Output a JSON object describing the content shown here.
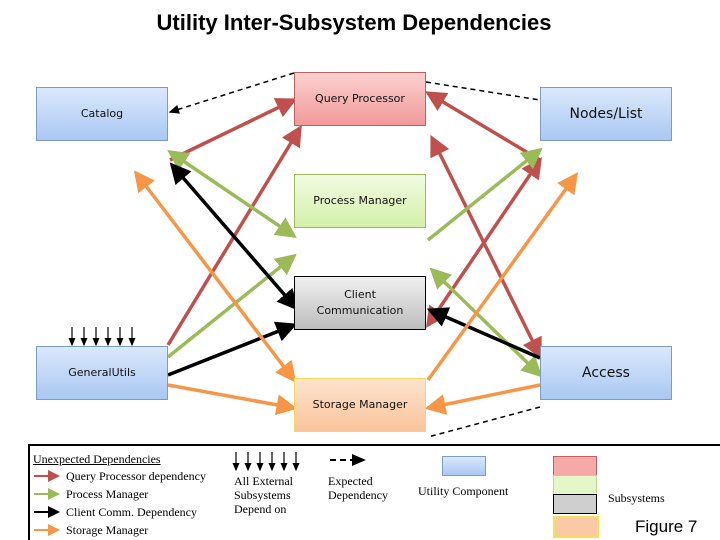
{
  "title": "Utility Inter-Subsystem Dependencies",
  "nodes": {
    "catalog": "Catalog",
    "query_processor": "Query Processor",
    "nodes_list": "Nodes/List",
    "process_manager": "Process Manager",
    "client_communication": "Client Communication",
    "general_utils": "GeneralUtils",
    "access": "Access",
    "storage_manager": "Storage Manager"
  },
  "colors": {
    "query_processor": "#c0504d",
    "process_manager": "#9bbb59",
    "client_comm": "#000000",
    "storage_manager": "#f79646"
  },
  "legend": {
    "heading": "Unexpected Dependencies",
    "items": [
      "Query Processor dependency",
      "Process Manager",
      "Client Comm. Dependency",
      "Storage Manager"
    ],
    "external": "All External Subsystems Depend on",
    "expected": "Expected Dependency",
    "utility": "Utility Component",
    "subsystems": "Subsystems",
    "figure": "Figure 7"
  }
}
